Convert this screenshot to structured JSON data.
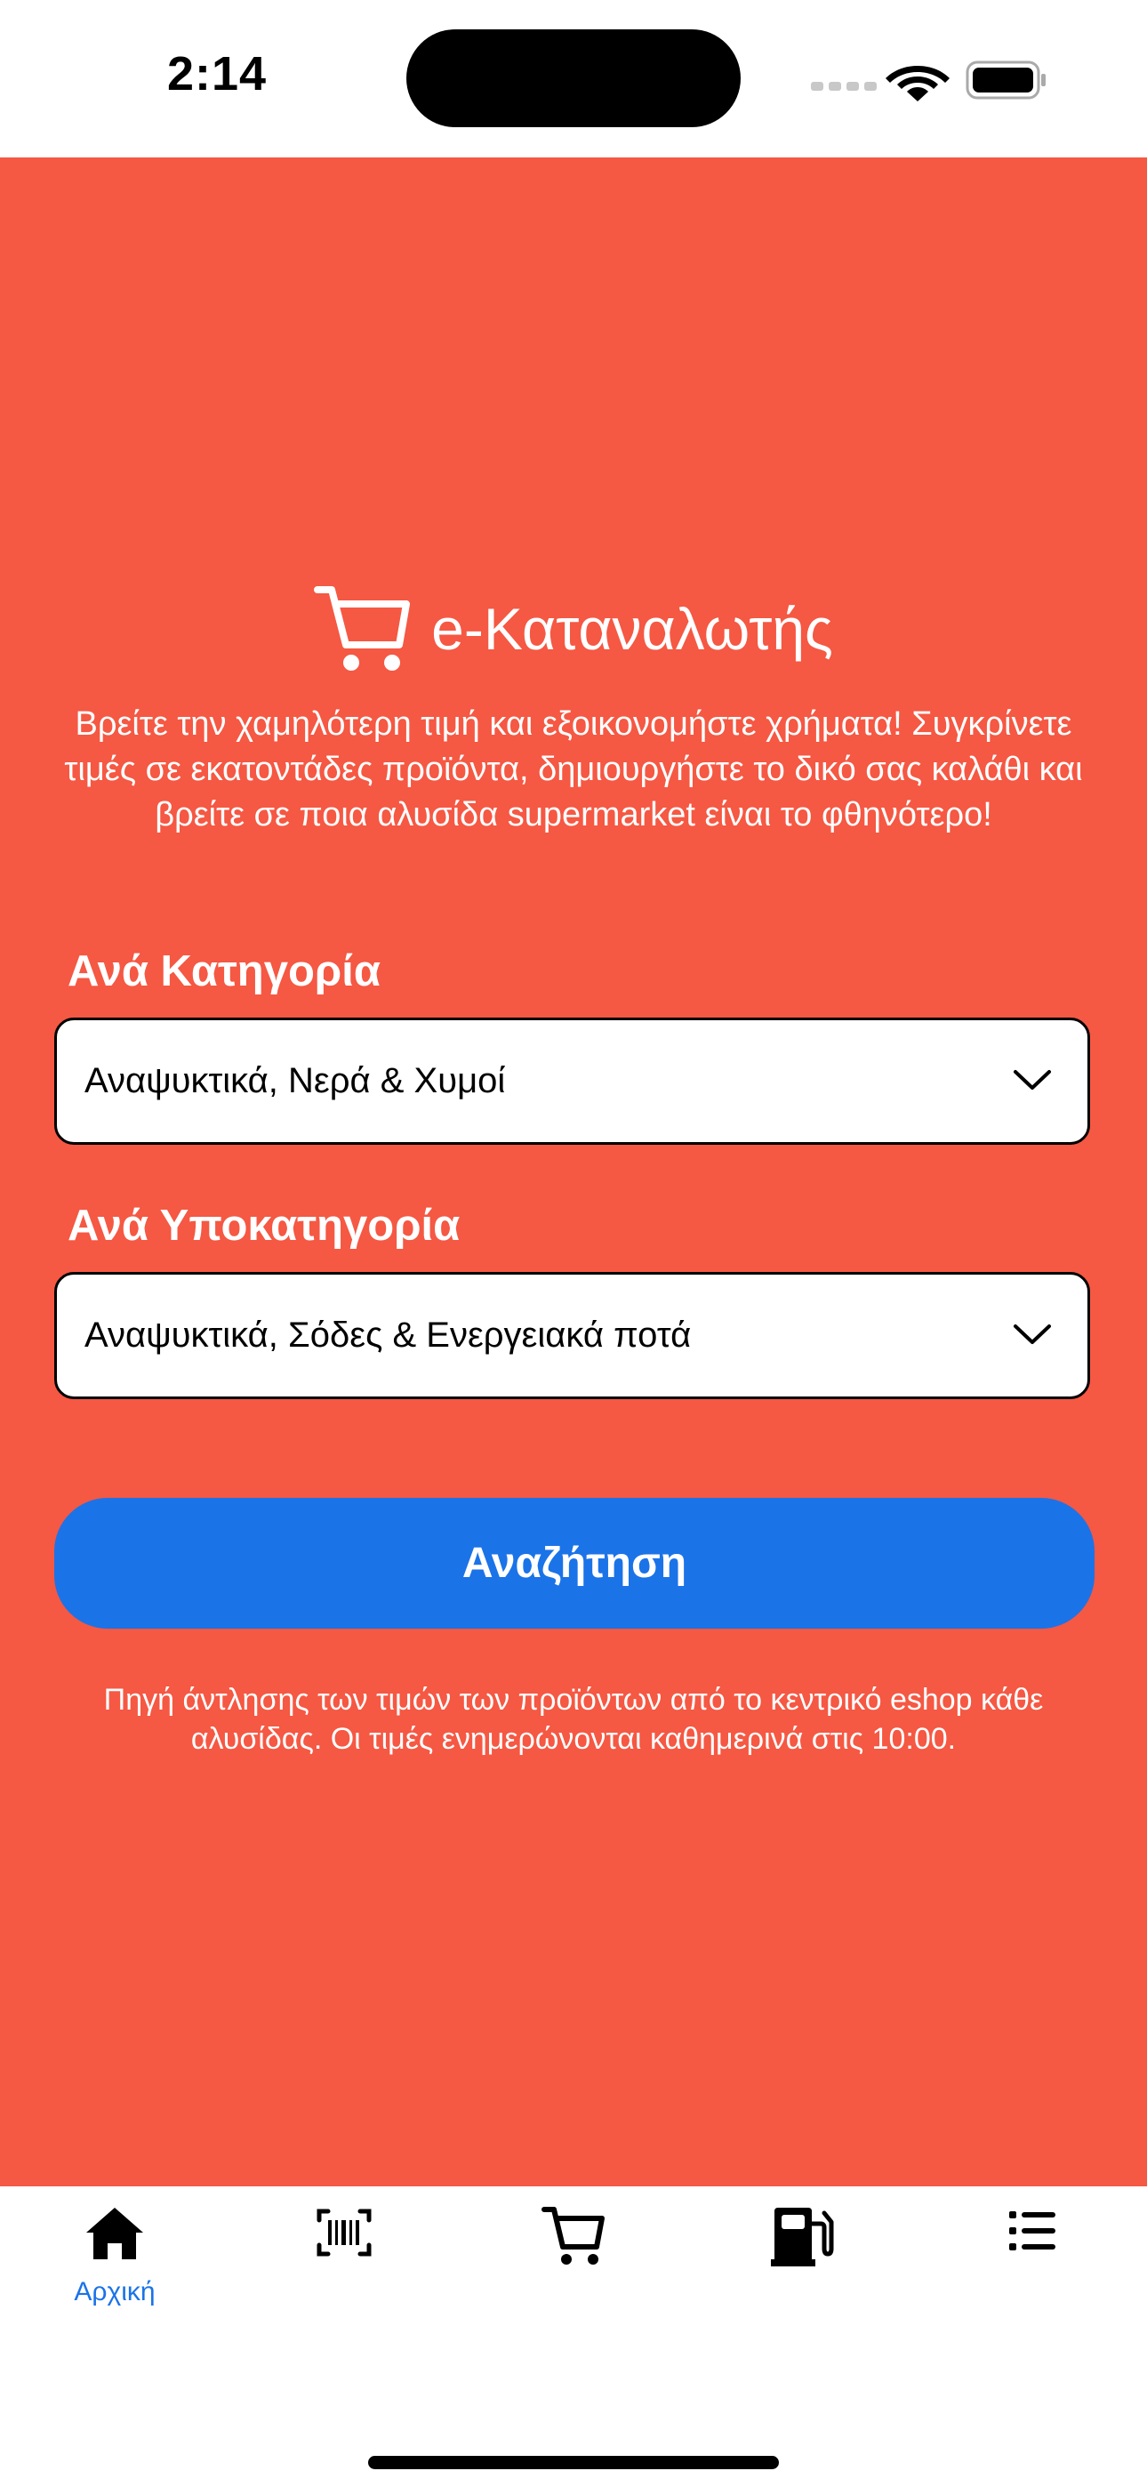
{
  "status_bar": {
    "time": "2:14",
    "icons": [
      "signal-icon",
      "wifi-icon",
      "battery-icon"
    ]
  },
  "app": {
    "title": "e-Καταναλωτής",
    "icon": "cart-icon",
    "intro": "Βρείτε την χαμηλότερη τιμή και εξοικονομήστε χρήματα! Συγκρίνετε τιμές σε εκατοντάδες προϊόντα, δημιουργήστε το δικό σας καλάθι και βρείτε σε ποια αλυσίδα supermarket είναι το φθηνότερο!"
  },
  "filters": {
    "category_label": "Ανά Κατηγορία",
    "category_value": "Αναψυκτικά, Νερά & Χυμοί",
    "subcategory_label": "Ανά Υποκατηγορία",
    "subcategory_value": "Αναψυκτικά, Σόδες & Ενεργειακά ποτά"
  },
  "search_button": "Αναζήτηση",
  "source_note": "Πηγή άντλησης των τιμών των προϊόντων από το κεντρικό eshop κάθε αλυσίδας. Οι τιμές ενημερώνονται καθημερινά στις 10:00.",
  "tab_bar": {
    "tabs": [
      {
        "icon": "home-icon",
        "label": "Αρχική",
        "active": true
      },
      {
        "icon": "barcode-icon",
        "label": "",
        "active": false
      },
      {
        "icon": "cart-icon",
        "label": "",
        "active": false
      },
      {
        "icon": "fuel-pump-icon",
        "label": "",
        "active": false
      },
      {
        "icon": "list-icon",
        "label": "",
        "active": false
      }
    ]
  },
  "colors": {
    "background": "#F55843",
    "button": "#1B73E8",
    "active_tab": "#1B73E8"
  }
}
